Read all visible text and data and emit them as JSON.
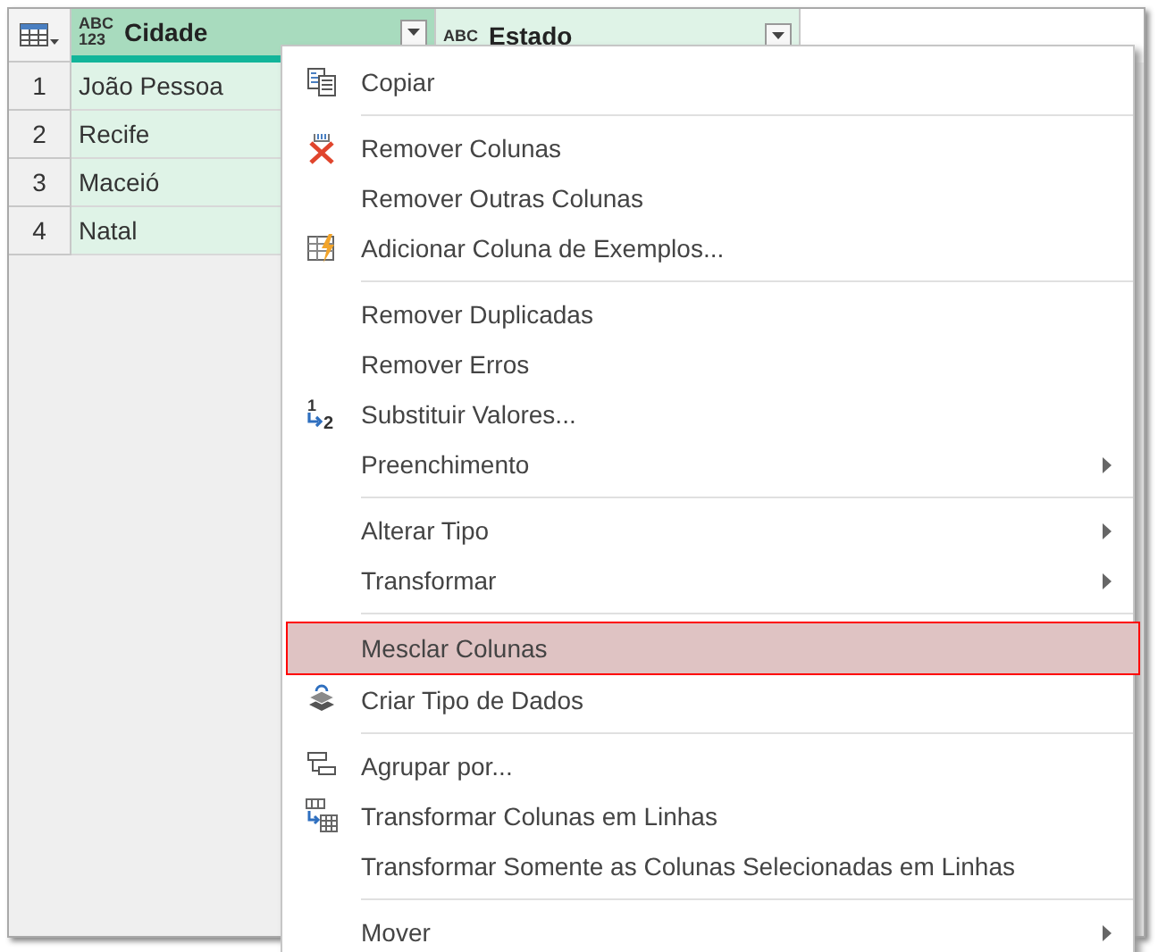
{
  "table": {
    "columns": [
      {
        "type": "ABC\n123",
        "name": "Cidade",
        "selected": true,
        "focused": true
      },
      {
        "type": "ABC",
        "name": "Estado",
        "selected": true,
        "focused": false
      }
    ],
    "rows": [
      {
        "number": "1",
        "cells": [
          "João Pessoa"
        ]
      },
      {
        "number": "2",
        "cells": [
          "Recife"
        ]
      },
      {
        "number": "3",
        "cells": [
          "Maceió"
        ]
      },
      {
        "number": "4",
        "cells": [
          "Natal"
        ]
      }
    ]
  },
  "context_menu": {
    "items": [
      {
        "kind": "item",
        "label": "Copiar",
        "submenu": false,
        "highlighted": false
      },
      {
        "kind": "separator"
      },
      {
        "kind": "item",
        "label": "Remover Colunas",
        "submenu": false,
        "highlighted": false
      },
      {
        "kind": "item",
        "label": "Remover Outras Colunas",
        "submenu": false,
        "highlighted": false
      },
      {
        "kind": "item",
        "label": "Adicionar Coluna de Exemplos...",
        "submenu": false,
        "highlighted": false
      },
      {
        "kind": "separator"
      },
      {
        "kind": "item",
        "label": "Remover Duplicadas",
        "submenu": false,
        "highlighted": false
      },
      {
        "kind": "item",
        "label": "Remover Erros",
        "submenu": false,
        "highlighted": false
      },
      {
        "kind": "item",
        "label": "Substituir Valores...",
        "icon_text": [
          "1",
          "2"
        ],
        "submenu": false,
        "highlighted": false
      },
      {
        "kind": "item",
        "label": "Preenchimento",
        "submenu": true,
        "highlighted": false
      },
      {
        "kind": "separator"
      },
      {
        "kind": "item",
        "label": "Alterar Tipo",
        "submenu": true,
        "highlighted": false
      },
      {
        "kind": "item",
        "label": "Transformar",
        "submenu": true,
        "highlighted": false
      },
      {
        "kind": "separator"
      },
      {
        "kind": "item",
        "label": "Mesclar Colunas",
        "submenu": false,
        "highlighted": true
      },
      {
        "kind": "item",
        "label": "Criar Tipo de Dados",
        "submenu": false,
        "highlighted": false
      },
      {
        "kind": "separator"
      },
      {
        "kind": "item",
        "label": "Agrupar por...",
        "submenu": false,
        "highlighted": false
      },
      {
        "kind": "item",
        "label": "Transformar Colunas em Linhas",
        "submenu": false,
        "highlighted": false
      },
      {
        "kind": "item",
        "label": "Transformar Somente as Colunas Selecionadas em Linhas",
        "submenu": false,
        "highlighted": false
      },
      {
        "kind": "separator"
      },
      {
        "kind": "item",
        "label": "Mover",
        "submenu": true,
        "highlighted": false
      }
    ]
  }
}
